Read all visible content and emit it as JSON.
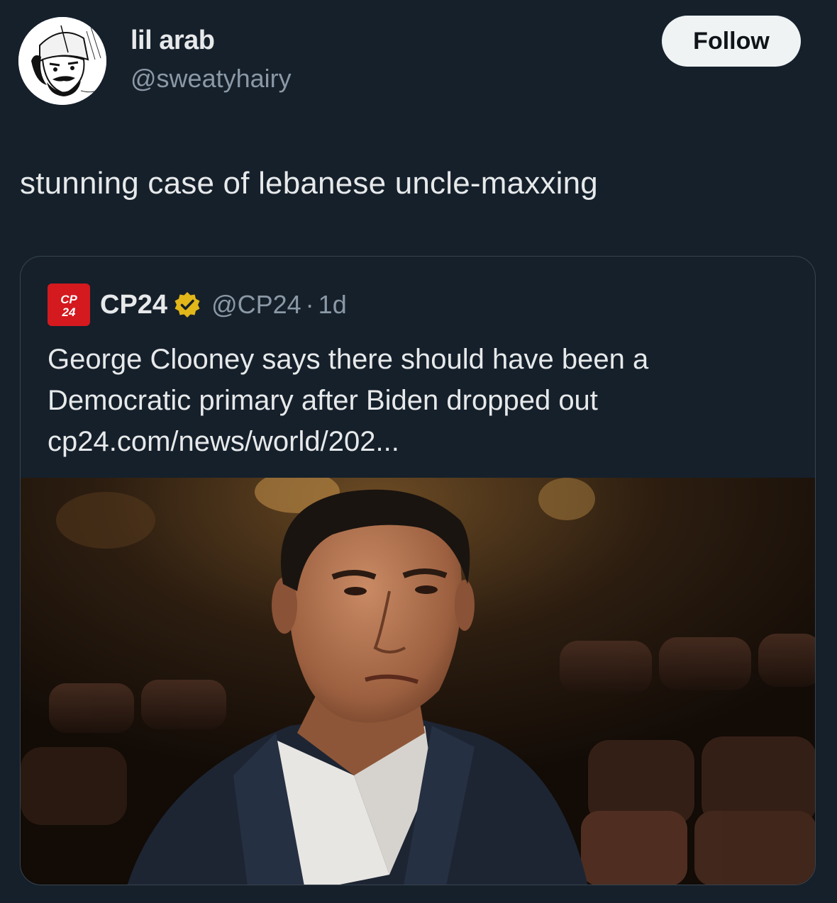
{
  "tweet": {
    "author_name": "lil arab",
    "author_handle": "@sweatyhairy",
    "follow_label": "Follow",
    "text": "stunning case of lebanese uncle-maxxing"
  },
  "quote": {
    "logo_text_top": "CP",
    "logo_text_bottom": "24",
    "name": "CP24",
    "handle": "@CP24",
    "separator": "·",
    "time": "1d",
    "text_line1": "George Clooney says there should have been a",
    "text_line2": "Democratic primary after Biden dropped out",
    "link": "cp24.com/news/world/202..."
  },
  "colors": {
    "background": "#15202b",
    "text_primary": "#e7e9ea",
    "text_secondary": "#8b98a5",
    "follow_bg": "#eff3f4",
    "brand_red": "#d4191f",
    "verified_gold": "#e2b719"
  },
  "icons": {
    "avatar": "sketch-avatar",
    "verified": "verified-badge-icon",
    "logo": "cp24-logo"
  }
}
